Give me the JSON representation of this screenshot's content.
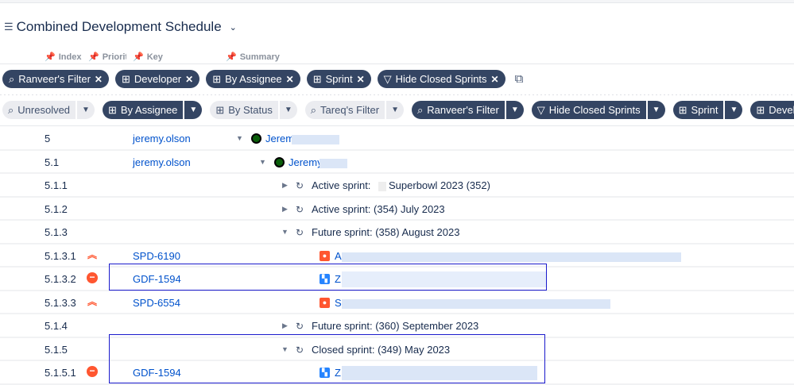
{
  "header": {
    "title": "Combined Development Schedule"
  },
  "columns": [
    "Index",
    "Priority",
    "Key",
    "Summary"
  ],
  "active_chips": [
    "Ranveer's Filter",
    "Developer",
    "By Assignee",
    "Sprint",
    "Hide Closed Sprints"
  ],
  "quick_filters": [
    "Unresolved",
    "By Assignee",
    "By Status",
    "Tareq's Filter",
    "Ranveer's Filter",
    "Hide Closed Sprints",
    "Sprint",
    "Develop"
  ],
  "rows": [
    {
      "index": "5",
      "key": "jeremy.olson",
      "summary": "Jerem"
    },
    {
      "index": "5.1",
      "key": "jeremy.olson",
      "summary": "Jeremy"
    },
    {
      "index": "5.1.1",
      "summary": "Active sprint:",
      "summary2": "Superbowl 2023 (352)"
    },
    {
      "index": "5.1.2",
      "summary": "Active sprint: (354) July 2023"
    },
    {
      "index": "5.1.3",
      "summary": "Future sprint: (358) August 2023"
    },
    {
      "index": "5.1.3.1",
      "key": "SPD-6190",
      "summary": "A"
    },
    {
      "index": "5.1.3.2",
      "key": "GDF-1594",
      "summary": "Z"
    },
    {
      "index": "5.1.3.3",
      "key": "SPD-6554",
      "summary": "S"
    },
    {
      "index": "5.1.4",
      "summary": "Future sprint: (360) September 2023"
    },
    {
      "index": "5.1.5",
      "summary": "Closed sprint: (349) May 2023"
    },
    {
      "index": "5.1.5.1",
      "key": "GDF-1594",
      "summary": "Z"
    }
  ]
}
